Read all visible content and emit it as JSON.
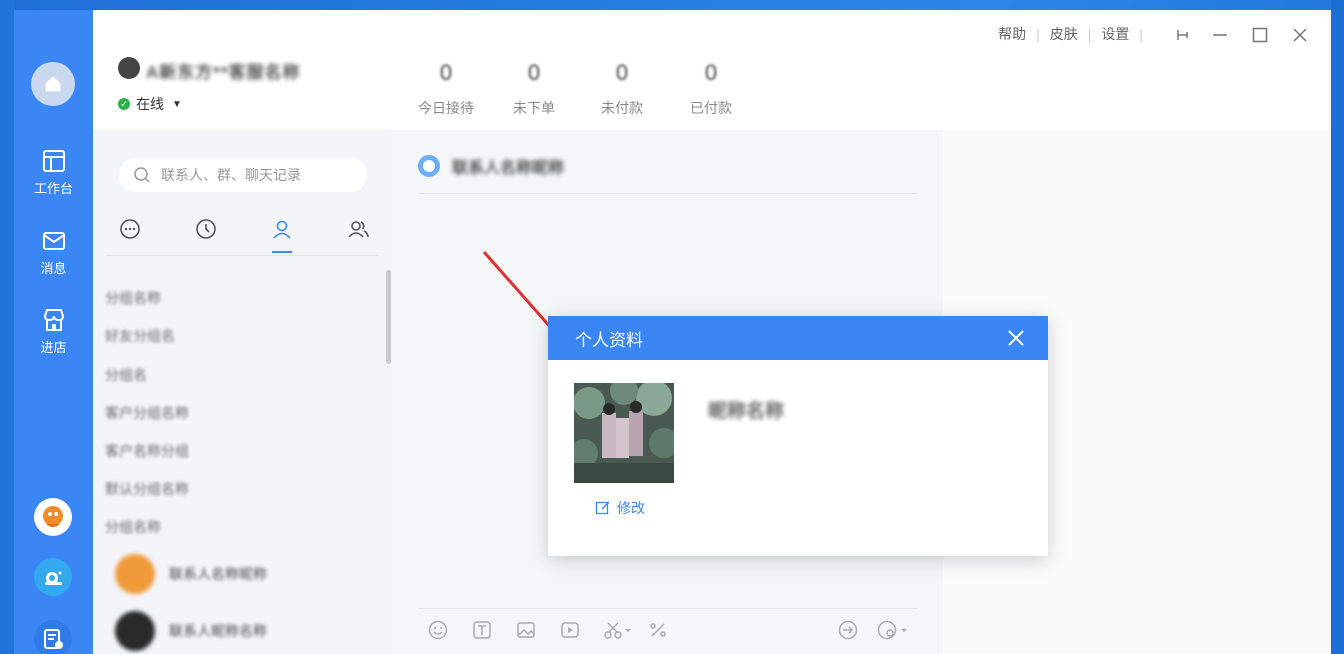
{
  "header": {
    "user_name": "A新东方**客服名称",
    "status": "在线",
    "stats": [
      {
        "value": "0",
        "label": "今日接待"
      },
      {
        "value": "0",
        "label": "未下单"
      },
      {
        "value": "0",
        "label": "未付款"
      },
      {
        "value": "0",
        "label": "已付款"
      }
    ],
    "links": [
      "帮助",
      "皮肤",
      "设置"
    ]
  },
  "nav": {
    "items": [
      "工作台",
      "消息",
      "进店"
    ]
  },
  "contacts": {
    "search_placeholder": "联系人、群、聊天记录",
    "groups": [
      "分组名称",
      "好友分组名",
      "分组名",
      "客户分组名称",
      "客户名称分组",
      "默认分组名称",
      "分组名称"
    ],
    "people": [
      {
        "name": "联系人名称昵称"
      },
      {
        "name": "联系人昵称名称"
      }
    ]
  },
  "chat": {
    "title": "联系人名称昵称"
  },
  "modal": {
    "title": "个人资料",
    "name": "昵称名称",
    "edit_label": "修改"
  },
  "colors": {
    "brand": "#3b86f5",
    "online": "#29b34a",
    "arrow": "#e03030"
  },
  "icons": {
    "nav": [
      "home-icon",
      "workbench-icon",
      "message-icon",
      "shop-icon"
    ],
    "tabs": [
      "chat-icon",
      "clock-icon",
      "user-icon",
      "group-icon"
    ]
  }
}
